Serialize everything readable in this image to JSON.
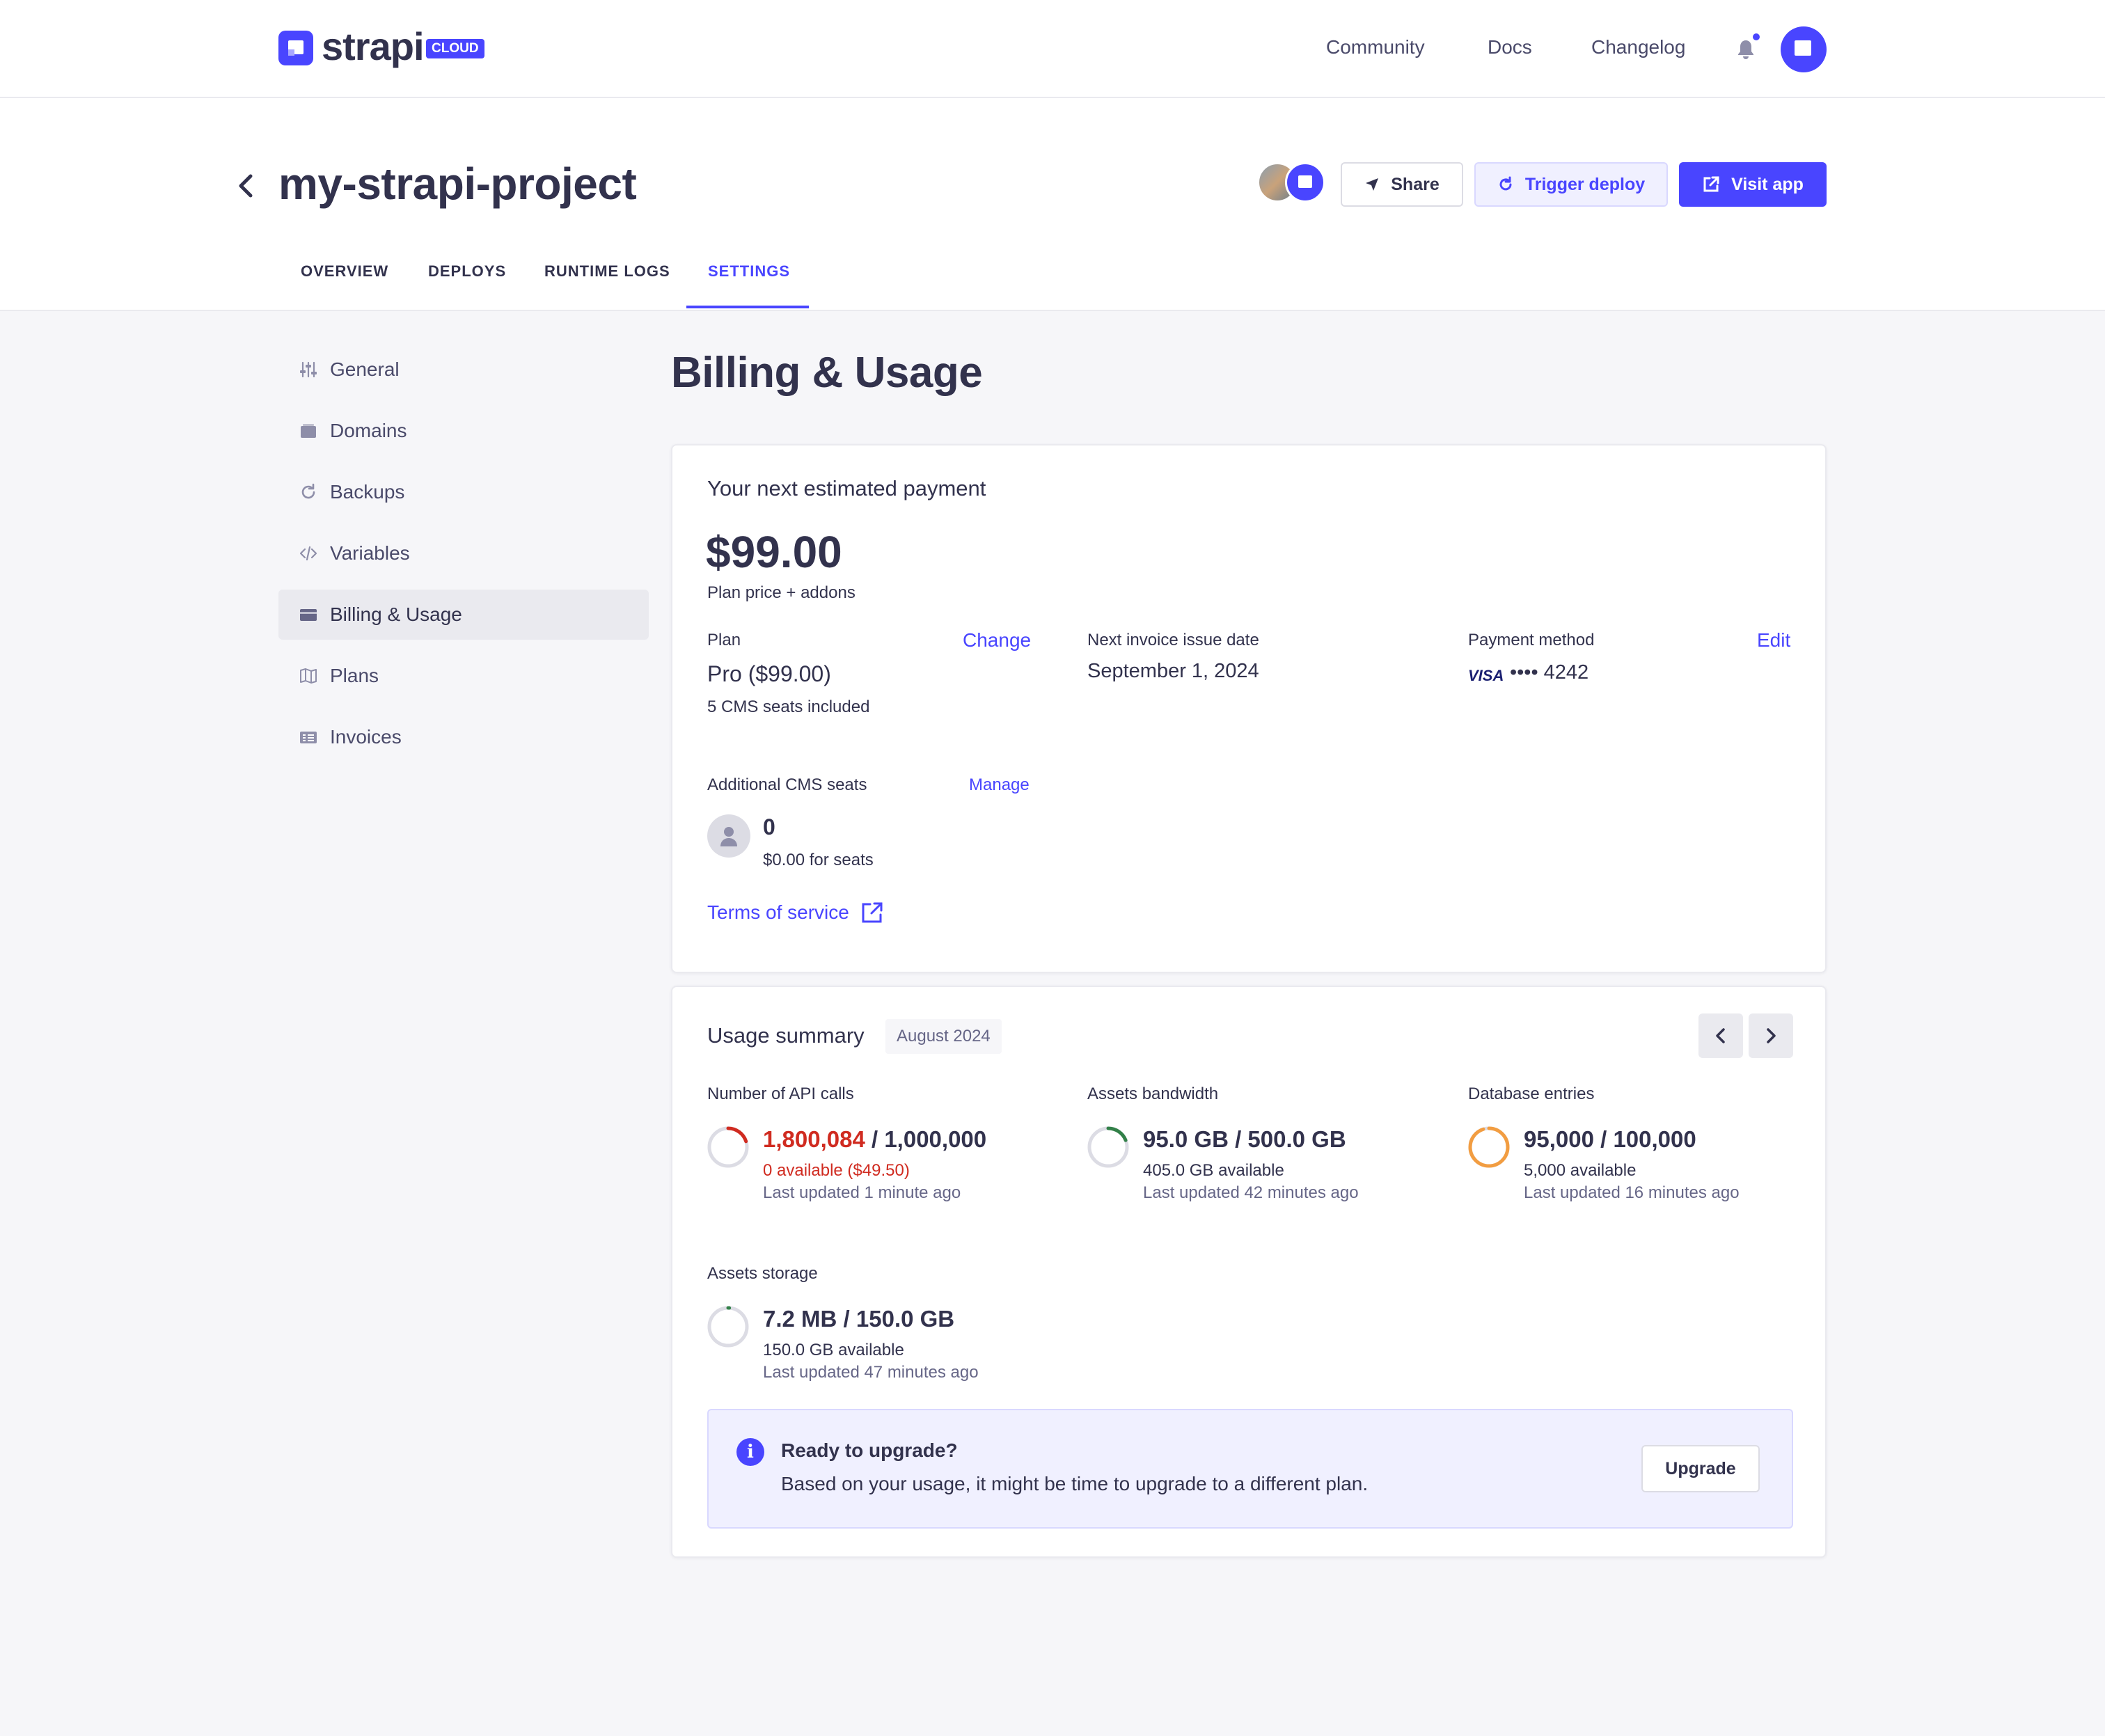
{
  "topnav": {
    "logo_text": "strapi",
    "logo_badge": "CLOUD",
    "links": [
      "Community",
      "Docs",
      "Changelog"
    ]
  },
  "project": {
    "title": "my-strapi-project",
    "buttons": {
      "share": "Share",
      "trigger_deploy": "Trigger deploy",
      "visit_app": "Visit app"
    },
    "tabs": [
      "OVERVIEW",
      "DEPLOYS",
      "RUNTIME LOGS",
      "SETTINGS"
    ],
    "active_tab": "SETTINGS"
  },
  "sidebar": {
    "items": [
      {
        "label": "General",
        "icon": "sliders-icon"
      },
      {
        "label": "Domains",
        "icon": "domain-icon"
      },
      {
        "label": "Backups",
        "icon": "refresh-icon"
      },
      {
        "label": "Variables",
        "icon": "code-icon"
      },
      {
        "label": "Billing & Usage",
        "icon": "credit-card-icon"
      },
      {
        "label": "Plans",
        "icon": "map-icon"
      },
      {
        "label": "Invoices",
        "icon": "invoice-icon"
      }
    ],
    "active": "Billing & Usage"
  },
  "page": {
    "title": "Billing & Usage"
  },
  "payment": {
    "heading": "Your next estimated payment",
    "amount": "$99.00",
    "amount_caption": "Plan price + addons",
    "plan": {
      "label": "Plan",
      "action": "Change",
      "value": "Pro ($99.00)",
      "sub": "5 CMS seats included"
    },
    "invoice": {
      "label": "Next invoice issue date",
      "value": "September 1, 2024"
    },
    "method": {
      "label": "Payment method",
      "action": "Edit",
      "brand": "VISA",
      "masked": "•••• 4242"
    },
    "seats": {
      "label": "Additional CMS seats",
      "action": "Manage",
      "count": "0",
      "cost": "$0.00 for seats"
    },
    "terms_link": "Terms of service"
  },
  "usage": {
    "heading": "Usage summary",
    "month": "August 2024",
    "metrics": [
      {
        "label": "Number of API calls",
        "used": "1,800,084",
        "total": "/ 1,000,000",
        "available": "0 available ($49.50)",
        "updated": "Last updated 1 minute ago",
        "fraction": 0.2,
        "color": "#d02b20",
        "over": true
      },
      {
        "label": "Assets bandwidth",
        "used": "95.0 GB",
        "total": "/ 500.0 GB",
        "available": "405.0 GB available",
        "updated": "Last updated 42 minutes ago",
        "fraction": 0.19,
        "color": "#328048",
        "over": false
      },
      {
        "label": "Database entries",
        "used": "95,000",
        "total": "/ 100,000",
        "available": "5,000 available",
        "updated": "Last updated 16 minutes ago",
        "fraction": 0.95,
        "color": "#f29d41",
        "over": false
      },
      {
        "label": "Assets storage",
        "used": "7.2 MB",
        "total": "/ 150.0 GB",
        "available": "150.0 GB available",
        "updated": "Last updated 47 minutes ago",
        "fraction": 0.01,
        "color": "#328048",
        "over": false
      }
    ],
    "alert": {
      "title": "Ready to upgrade?",
      "body": "Based on your usage, it might be time to upgrade to a different plan.",
      "button": "Upgrade"
    }
  },
  "colors": {
    "primary": "#4945ff",
    "danger": "#d02b20",
    "success": "#328048",
    "warning": "#f29d41"
  }
}
